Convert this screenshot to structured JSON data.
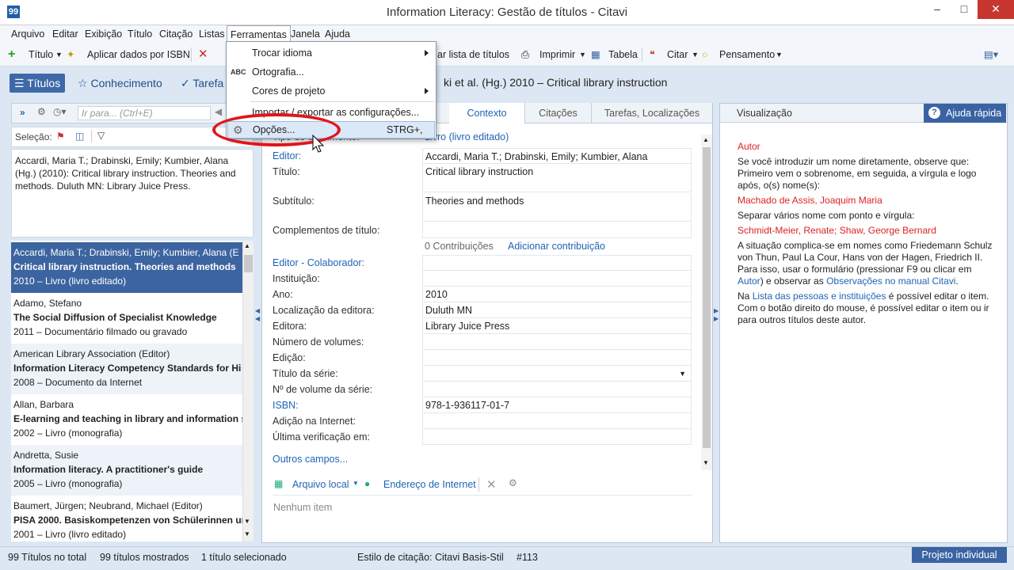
{
  "window": {
    "title": "Information Literacy: Gestão de títulos - Citavi",
    "app_icon": "99"
  },
  "menubar": [
    "Arquivo",
    "Editar",
    "Exibição",
    "Título",
    "Citação",
    "Listas",
    "Ferramentas",
    "Janela",
    "Ajuda"
  ],
  "toolbar": {
    "titulo": "Título",
    "aplicar": "Aplicar dados por ISBN",
    "lista": "ar lista de títulos",
    "imprimir": "Imprimir",
    "tabela": "Tabela",
    "citar": "Citar",
    "pensamento": "Pensamento"
  },
  "nav": {
    "titulos": "Títulos",
    "conhecimento": "Conhecimento",
    "tarefas": "Tarefa"
  },
  "header_title": "ki et al. (Hg.) 2010 – Critical library instruction",
  "left": {
    "search_placeholder": "Ir para... (Ctrl+E)",
    "selecao": "Seleção:",
    "citation": "Accardi, Maria T.; Drabinski, Emily; Kumbier, Alana (Hg.) (2010): Critical library instruction. Theories and methods. Duluth MN: Library Juice Press.",
    "items": [
      {
        "author": "Accardi, Maria T.; Drabinski, Emily; Kumbier, Alana (E",
        "title": "Critical library instruction. Theories and methods",
        "meta": "2010 – Livro (livro editado)"
      },
      {
        "author": "Adamo, Stefano",
        "title": "The Social Diffusion of Specialist Knowledge",
        "meta": "2011 – Documentário filmado ou gravado"
      },
      {
        "author": "American Library Association (Editor)",
        "title": "Information Literacy Competency Standards for Hi",
        "meta": "2008 – Documento da Internet"
      },
      {
        "author": "Allan, Barbara",
        "title": "E-learning and teaching in library and information s",
        "meta": "2002 – Livro (monografia)"
      },
      {
        "author": "Andretta, Susie",
        "title": "Information literacy. A practitioner's guide",
        "meta": "2005 – Livro (monografia)"
      },
      {
        "author": "Baumert, Jürgen; Neubrand, Michael (Editor)",
        "title": "PISA 2000. Basiskompetenzen von Schülerinnen un",
        "meta": "2001 – Livro (livro editado)"
      }
    ]
  },
  "center": {
    "tabs": [
      "Contexto",
      "Citações",
      "Tarefas, Localizações"
    ],
    "type_value": "Livro (livro editado)",
    "type_label_tail": "Tipo de documento:",
    "fields": [
      {
        "label": "Editor:",
        "value": "Accardi, Maria T.; Drabinski, Emily; Kumbier, Alana",
        "link": true
      },
      {
        "label": "Título:",
        "value": "Critical library instruction",
        "link": false
      },
      {
        "label": "Subtítulo:",
        "value": "Theories and methods",
        "link": false
      },
      {
        "label": "Complementos de título:",
        "value": "",
        "link": false
      },
      {
        "label": "Editor - Colaborador:",
        "value": "",
        "link": true
      },
      {
        "label": "Instituição:",
        "value": "",
        "link": false
      },
      {
        "label": "Ano:",
        "value": "2010",
        "link": false
      },
      {
        "label": "Localização da editora:",
        "value": "Duluth MN",
        "link": false
      },
      {
        "label": "Editora:",
        "value": "Library Juice Press",
        "link": false
      },
      {
        "label": "Número de volumes:",
        "value": "",
        "link": false
      },
      {
        "label": "Edição:",
        "value": "",
        "link": false
      },
      {
        "label": "Título da série:",
        "value": "",
        "link": false
      },
      {
        "label": "Nº de volume da série:",
        "value": "",
        "link": false
      },
      {
        "label": "ISBN:",
        "value": "978-1-936117-01-7",
        "link": true
      },
      {
        "label": "Adição na Internet:",
        "value": "",
        "link": false
      },
      {
        "label": "Última verificação em:",
        "value": "",
        "link": false
      }
    ],
    "contribs": "0 Contribuições",
    "add_contrib": "Adicionar contribuição",
    "outros": "Outros campos...",
    "arquivo_local": "Arquivo local",
    "endereco": "Endereço de Internet",
    "nenhum": "Nenhum item"
  },
  "right": {
    "visualizacao": "Visualização",
    "ajuda": "Ajuda rápida",
    "autor": "Autor",
    "p1": "Se você introduzir um nome diretamente, observe que: Primeiro vem o sobrenome, em seguida, a vírgula e logo após, o(s) nome(s):",
    "ex1": "Machado de Assis, Joaquim Maria",
    "p2": "Separar vários nome com ponto e vírgula:",
    "ex2": "Schmidt-Meier, Renate; Shaw, George Bernard",
    "p3a": "A situação complica-se em nomes como Friedemann Schulz von Thun, Paul La Cour, Hans von der Hagen, Friedrich II. Para isso, usar o formulário (pressionar F9 ou clicar em ",
    "p3link1": "Autor",
    "p3b": ") e observar as ",
    "p3link2": "Observações no manual Citavi",
    "p3c": ".",
    "p4a": "Na ",
    "p4link": "Lista das pessoas e instituições",
    "p4b": "  é possível editar o item. Com o botão direito do mouse, é possível editar o item ou ir para outros títulos deste autor."
  },
  "status": {
    "total": "99 Títulos no total",
    "mostrados": "99 títulos mostrados",
    "selecionado": "1 título selecionado",
    "estilo": "Estilo de citação: Citavi Basis-Stil",
    "num": "#113",
    "projeto": "Projeto individual"
  },
  "dropdown": [
    {
      "label": "Trocar idioma",
      "shortcut": "",
      "submenu": true
    },
    {
      "label": "Ortografia...",
      "shortcut": "",
      "submenu": false
    },
    {
      "label": "Cores de projeto",
      "shortcut": "",
      "submenu": true
    },
    {
      "label": "Importar / exportar as configurações...",
      "shortcut": "",
      "submenu": false
    },
    {
      "label": "Opções...",
      "shortcut": "STRG+,",
      "submenu": false
    }
  ],
  "colors": {
    "accent": "#3a63a3",
    "selected_row": "#3c64a0",
    "link": "#1f64b4",
    "highlight_oval": "#e0151b"
  }
}
